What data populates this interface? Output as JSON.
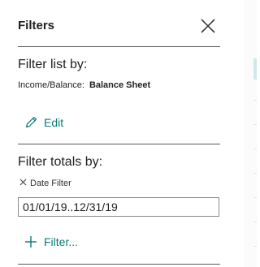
{
  "panel": {
    "title": "Filters"
  },
  "filter_list": {
    "heading": "Filter list by:",
    "field_label": "Income/Balance:",
    "field_value": "Balance Sheet",
    "edit_label": "Edit"
  },
  "filter_totals": {
    "heading": "Filter totals by:",
    "date_filter_label": "Date Filter",
    "date_filter_value": "01/01/19..12/31/19",
    "add_filter_label": "Filter..."
  },
  "colors": {
    "accent": "#0a7a77",
    "text": "#212121",
    "divider": "#5a5a5a"
  }
}
